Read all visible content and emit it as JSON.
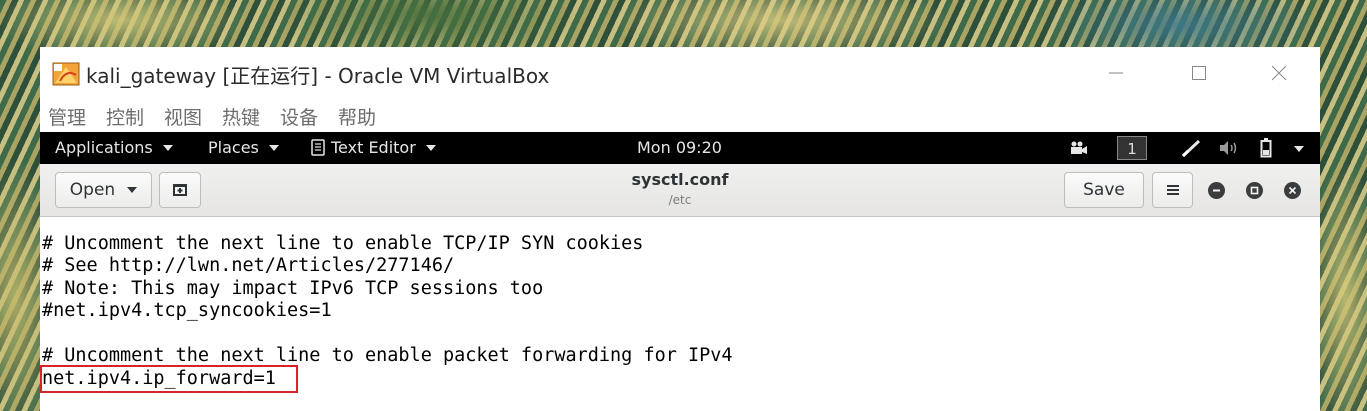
{
  "window": {
    "title": "kali_gateway [正在运行] - Oracle VM VirtualBox",
    "minimize_icon": "minimize-icon",
    "maximize_icon": "maximize-icon",
    "close_icon": "close-icon"
  },
  "menubar": {
    "items": [
      "管理",
      "控制",
      "视图",
      "热键",
      "设备",
      "帮助"
    ]
  },
  "top_bar": {
    "applications": "Applications",
    "places": "Places",
    "text_editor": "Text Editor",
    "clock": "Mon 09:20",
    "workspace": "1"
  },
  "headerbar": {
    "open_label": "Open",
    "save_label": "Save",
    "file_name": "sysctl.conf",
    "file_path": "/etc"
  },
  "editor": {
    "lines": [
      "# Uncomment the next line to enable TCP/IP SYN cookies",
      "# See http://lwn.net/Articles/277146/",
      "# Note: This may impact IPv6 TCP sessions too",
      "#net.ipv4.tcp_syncookies=1",
      "",
      "# Uncomment the next line to enable packet forwarding for IPv4",
      "net.ipv4.ip_forward=1"
    ],
    "highlight_color": "#d9232a"
  }
}
